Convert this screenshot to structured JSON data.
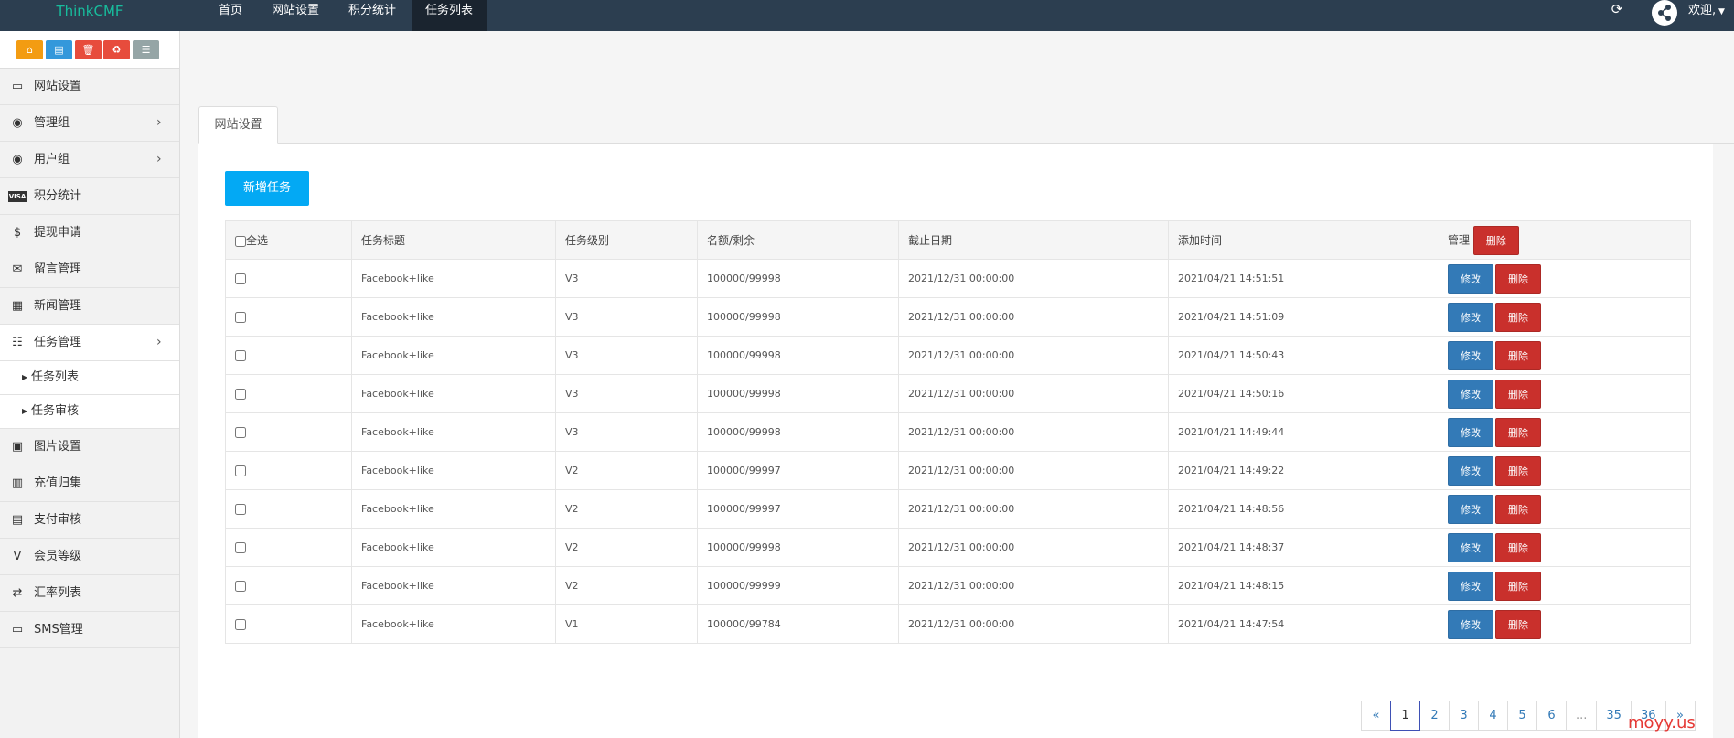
{
  "app": {
    "brand": "ThinkCMF",
    "welcome": "欢迎,"
  },
  "topnav": [
    {
      "label": "首页",
      "active": false
    },
    {
      "label": "网站设置",
      "active": false
    },
    {
      "label": "积分统计",
      "active": false
    },
    {
      "label": "任务列表",
      "active": true
    }
  ],
  "quick_buttons": [
    {
      "icon": "home-icon",
      "color": "#f39c12"
    },
    {
      "icon": "file-icon",
      "color": "#3498db"
    },
    {
      "icon": "trash-icon",
      "color": "#e74c3c"
    },
    {
      "icon": "recycle-icon",
      "color": "#e74c3c"
    },
    {
      "icon": "list-icon",
      "color": "#95a5a6"
    }
  ],
  "sidebar": {
    "items": [
      {
        "label": "网站设置",
        "icon": "monitor-icon",
        "chevron": false
      },
      {
        "label": "管理组",
        "icon": "user-circle-icon",
        "chevron": true
      },
      {
        "label": "用户组",
        "icon": "user-circle-icon",
        "chevron": true
      },
      {
        "label": "积分统计",
        "icon": "visa-icon",
        "chevron": false
      },
      {
        "label": "提现申请",
        "icon": "dollar-icon",
        "chevron": false
      },
      {
        "label": "留言管理",
        "icon": "envelope-icon",
        "chevron": false
      },
      {
        "label": "新闻管理",
        "icon": "newspaper-icon",
        "chevron": false
      },
      {
        "label": "任务管理",
        "icon": "tasks-icon",
        "chevron": true,
        "active": true
      },
      {
        "label": "图片设置",
        "icon": "image-icon",
        "chevron": false
      },
      {
        "label": "充值归集",
        "icon": "money-icon",
        "chevron": false
      },
      {
        "label": "支付审核",
        "icon": "id-card-icon",
        "chevron": false
      },
      {
        "label": "会员等级",
        "icon": "vine-icon",
        "chevron": false
      },
      {
        "label": "汇率列表",
        "icon": "exchange-icon",
        "chevron": false
      },
      {
        "label": "SMS管理",
        "icon": "monitor-icon",
        "chevron": false
      }
    ],
    "sub_items": [
      "任务列表",
      "任务审核"
    ]
  },
  "tab": {
    "label": "网站设置"
  },
  "toolbar": {
    "add_label": "新增任务"
  },
  "table": {
    "headers": {
      "select_all": "全选",
      "title": "任务标题",
      "level": "任务级别",
      "quota": "名额/剩余",
      "deadline": "截止日期",
      "added": "添加时间",
      "manage": "管理",
      "batch_delete": "删除"
    },
    "edit_label": "修改",
    "delete_label": "删除",
    "rows": [
      {
        "title": "Facebook+like",
        "level": "V3",
        "quota": "100000/99998",
        "deadline": "2021/12/31 00:00:00",
        "added": "2021/04/21 14:51:51"
      },
      {
        "title": "Facebook+like",
        "level": "V3",
        "quota": "100000/99998",
        "deadline": "2021/12/31 00:00:00",
        "added": "2021/04/21 14:51:09"
      },
      {
        "title": "Facebook+like",
        "level": "V3",
        "quota": "100000/99998",
        "deadline": "2021/12/31 00:00:00",
        "added": "2021/04/21 14:50:43"
      },
      {
        "title": "Facebook+like",
        "level": "V3",
        "quota": "100000/99998",
        "deadline": "2021/12/31 00:00:00",
        "added": "2021/04/21 14:50:16"
      },
      {
        "title": "Facebook+like",
        "level": "V3",
        "quota": "100000/99998",
        "deadline": "2021/12/31 00:00:00",
        "added": "2021/04/21 14:49:44"
      },
      {
        "title": "Facebook+like",
        "level": "V2",
        "quota": "100000/99997",
        "deadline": "2021/12/31 00:00:00",
        "added": "2021/04/21 14:49:22"
      },
      {
        "title": "Facebook+like",
        "level": "V2",
        "quota": "100000/99997",
        "deadline": "2021/12/31 00:00:00",
        "added": "2021/04/21 14:48:56"
      },
      {
        "title": "Facebook+like",
        "level": "V2",
        "quota": "100000/99998",
        "deadline": "2021/12/31 00:00:00",
        "added": "2021/04/21 14:48:37"
      },
      {
        "title": "Facebook+like",
        "level": "V2",
        "quota": "100000/99999",
        "deadline": "2021/12/31 00:00:00",
        "added": "2021/04/21 14:48:15"
      },
      {
        "title": "Facebook+like",
        "level": "V1",
        "quota": "100000/99784",
        "deadline": "2021/12/31 00:00:00",
        "added": "2021/04/21 14:47:54"
      }
    ]
  },
  "pagination": [
    "«",
    "1",
    "2",
    "3",
    "4",
    "5",
    "6",
    "...",
    "35",
    "36",
    "»"
  ],
  "pagination_active": "1",
  "watermark": "moyy.us"
}
